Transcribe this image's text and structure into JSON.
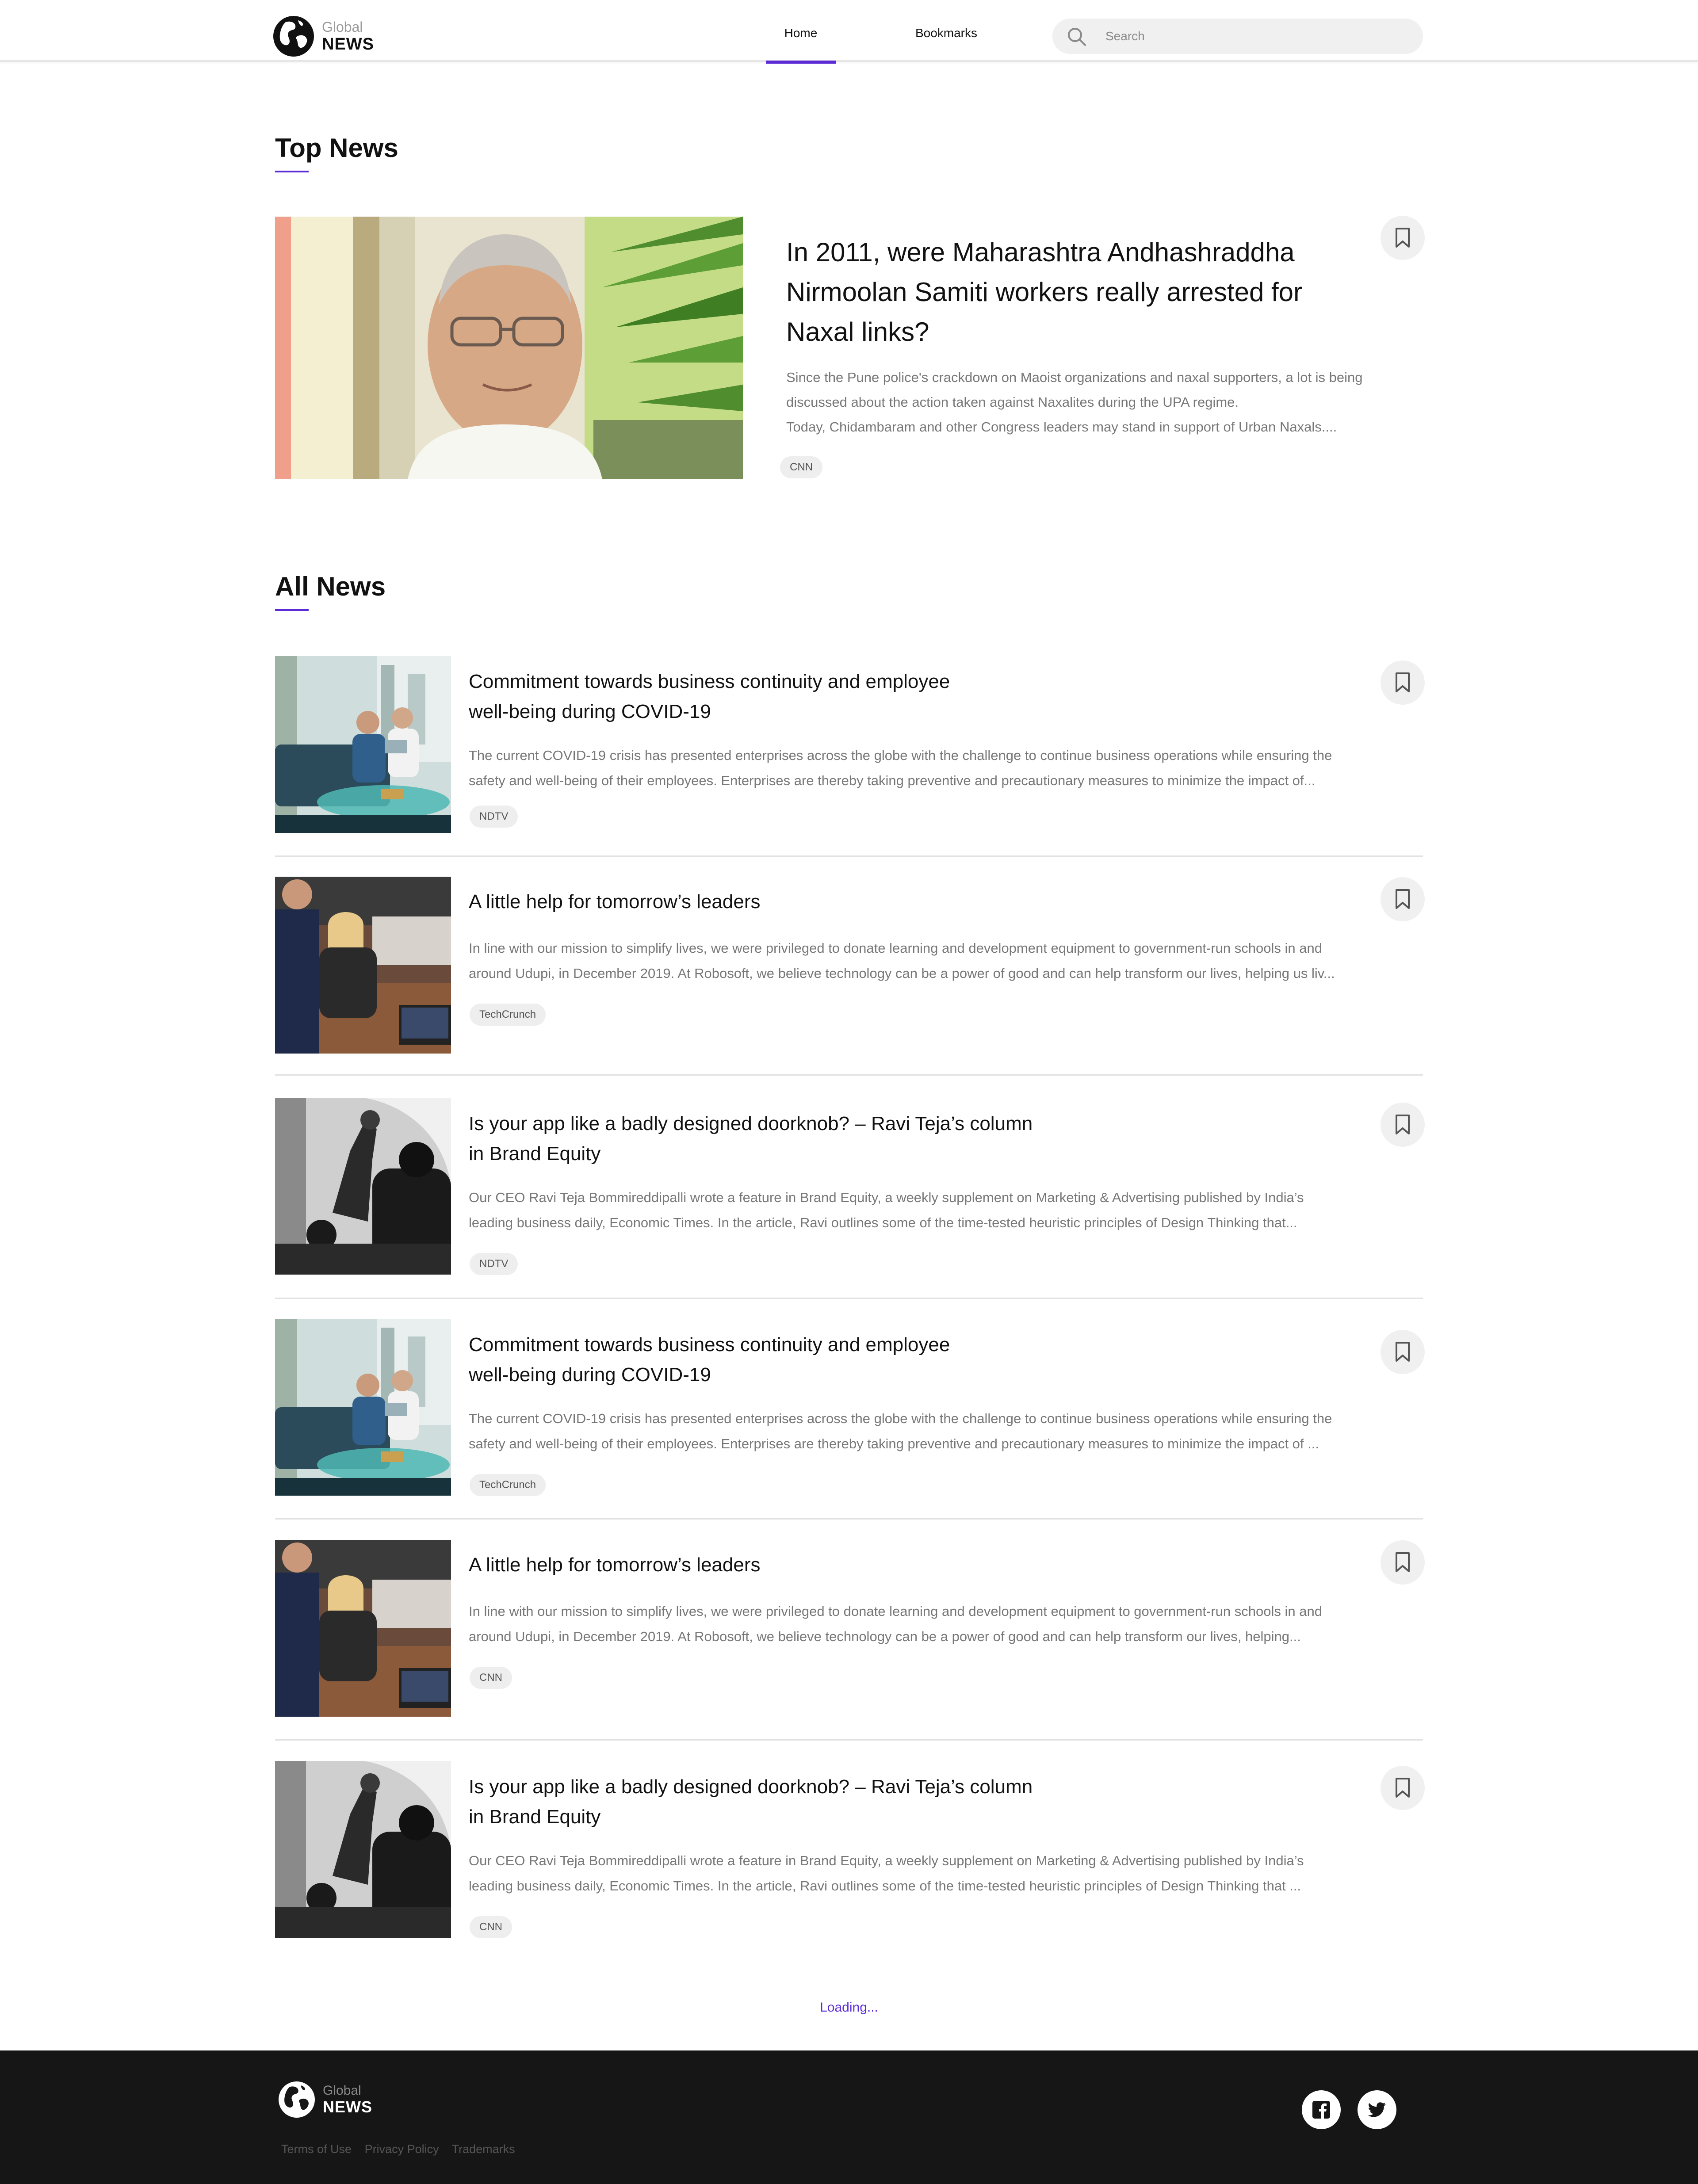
{
  "header": {
    "logo_top": "Global",
    "logo_bottom": "NEWS",
    "nav": {
      "home": "Home",
      "bookmarks": "Bookmarks"
    },
    "search_placeholder": "Search"
  },
  "top_news": {
    "heading": "Top News",
    "title_lines": [
      "In 2011, were Maharashtra Andhashraddha",
      "Nirmoolan Samiti workers really arrested for",
      "Naxal links?"
    ],
    "desc_lines": [
      "Since the Pune police's crackdown on Maoist organizations and naxal supporters, a lot is being",
      "discussed about the action taken against Naxalites during the UPA regime.",
      "Today, Chidambaram and other Congress leaders may stand in support of Urban Naxals...."
    ],
    "source": "CNN"
  },
  "all_news": {
    "heading": "All News",
    "items": [
      {
        "title_lines": [
          "Commitment towards business continuity and employee",
          "well-being during COVID-19"
        ],
        "desc_lines": [
          "The current COVID-19 crisis has presented enterprises across the globe with the challenge to continue business operations while ensuring the",
          "safety and well-being of their employees. Enterprises are thereby taking preventive and precautionary measures to minimize the impact of..."
        ],
        "source": "NDTV"
      },
      {
        "title_lines": [
          "A little help for tomorrow’s leaders"
        ],
        "desc_lines": [
          "In line with our mission to simplify lives, we were privileged to donate learning and development equipment to government-run schools in and",
          "around Udupi, in December 2019. At Robosoft, we believe technology can be a power of good and can help transform our lives, helping us liv..."
        ],
        "source": "TechCrunch"
      },
      {
        "title_lines": [
          "Is your app like a badly designed doorknob? – Ravi Teja’s column",
          "in Brand Equity"
        ],
        "desc_lines": [
          "Our CEO Ravi Teja Bommireddipalli wrote a feature in Brand Equity, a weekly supplement on Marketing & Advertising published by India’s",
          "leading business daily, Economic Times. In the article, Ravi outlines some of the time-tested heuristic principles of Design Thinking that..."
        ],
        "source": "NDTV"
      },
      {
        "title_lines": [
          "Commitment towards business continuity and employee",
          "well-being during COVID-19"
        ],
        "desc_lines": [
          "The current COVID-19 crisis has presented enterprises across the globe with the challenge to continue business operations while ensuring the",
          "safety and well-being of their employees. Enterprises are thereby taking preventive and precautionary measures to minimize the impact of ..."
        ],
        "source": "TechCrunch"
      },
      {
        "title_lines": [
          "A little help for tomorrow’s leaders"
        ],
        "desc_lines": [
          "In line with our mission to simplify lives, we were privileged to donate learning and development equipment to government-run schools in and",
          "around Udupi, in December 2019. At Robosoft, we believe technology can be a power of good and can help transform our lives, helping..."
        ],
        "source": "CNN"
      },
      {
        "title_lines": [
          "Is your app like a badly designed doorknob? – Ravi Teja’s column",
          "in Brand Equity"
        ],
        "desc_lines": [
          "Our CEO Ravi Teja Bommireddipalli wrote a feature in Brand Equity, a weekly supplement on Marketing & Advertising published by India’s",
          "leading business daily, Economic Times. In the article, Ravi outlines some of the time-tested heuristic principles of Design Thinking that ..."
        ],
        "source": "CNN"
      }
    ]
  },
  "loading": "Loading...",
  "footer": {
    "logo_top": "Global",
    "logo_bottom": "NEWS",
    "links": [
      "Terms of Use",
      "Privacy Policy",
      "Trademarks"
    ],
    "social": [
      "facebook-icon",
      "twitter-icon"
    ]
  },
  "colors": {
    "accent": "#5b2bd6",
    "footer_bg": "#161616",
    "tag_bg": "#eeeeee"
  }
}
